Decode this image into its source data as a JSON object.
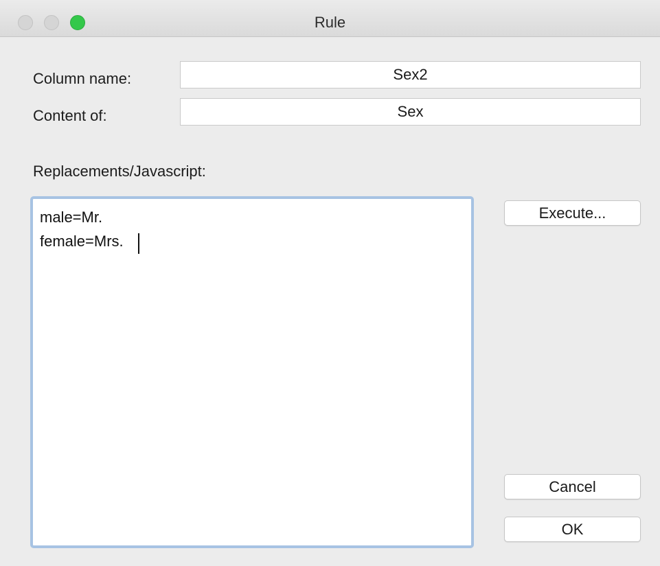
{
  "window": {
    "title": "Rule"
  },
  "form": {
    "column_name_label": "Column name:",
    "column_name_value": "Sex2",
    "content_of_label": "Content of:",
    "content_of_value": "Sex",
    "replacements_label": "Replacements/Javascript:",
    "replacements_lines": [
      "male=Mr.",
      "female=Mrs."
    ]
  },
  "buttons": {
    "execute": "Execute...",
    "cancel": "Cancel",
    "ok": "OK"
  },
  "colors": {
    "zoom_button": "#34c84a",
    "focus_ring": "#a7c3e3"
  }
}
